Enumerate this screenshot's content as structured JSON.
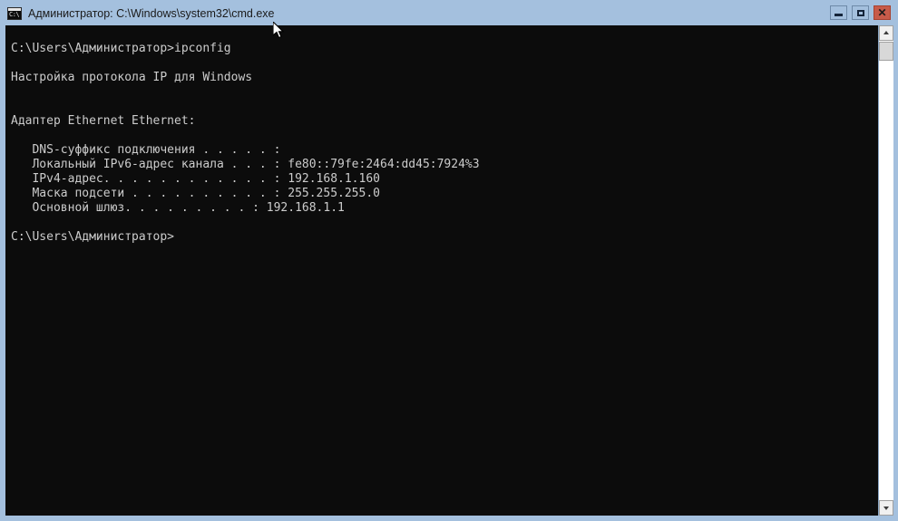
{
  "window": {
    "title": "Администратор: C:\\Windows\\system32\\cmd.exe",
    "icon_name": "cmd-icon",
    "icon_text": "C:\\",
    "frame_color": "#a4c0de",
    "console_bg": "#0c0c0c",
    "console_fg": "#cccccc",
    "close_button_color": "#c75b4a"
  },
  "caption": {
    "minimize_label": "–",
    "maximize_label": "□",
    "close_label": "✕"
  },
  "console": {
    "lines": [
      "C:\\Users\\Администратор>ipconfig",
      "",
      "Настройка протокола IP для Windows",
      "",
      "",
      "Адаптер Ethernet Ethernet:",
      "",
      "   DNS-суффикс подключения . . . . . :",
      "   Локальный IPv6-адрес канала . . . : fe80::79fe:2464:dd45:7924%3",
      "   IPv4-адрес. . . . . . . . . . . . : 192.168.1.160",
      "   Маска подсети . . . . . . . . . . : 255.255.255.0",
      "   Основной шлюз. . . . . . . . . : 192.168.1.1",
      "",
      "C:\\Users\\Администратор>"
    ],
    "command": "ipconfig",
    "prompt": "C:\\Users\\Администратор>",
    "header": "Настройка протокола IP для Windows",
    "adapter": "Адаптер Ethernet Ethernet:",
    "fields": [
      {
        "label": "DNS-суффикс подключения",
        "value": ""
      },
      {
        "label": "Локальный IPv6-адрес канала",
        "value": "fe80::79fe:2464:dd45:7924%3"
      },
      {
        "label": "IPv4-адрес",
        "value": "192.168.1.160"
      },
      {
        "label": "Маска подсети",
        "value": "255.255.255.0"
      },
      {
        "label": "Основной шлюз",
        "value": "192.168.1.1"
      }
    ]
  },
  "scrollbar": {
    "up_arrow": "scroll-up-arrow",
    "down_arrow": "scroll-down-arrow"
  }
}
